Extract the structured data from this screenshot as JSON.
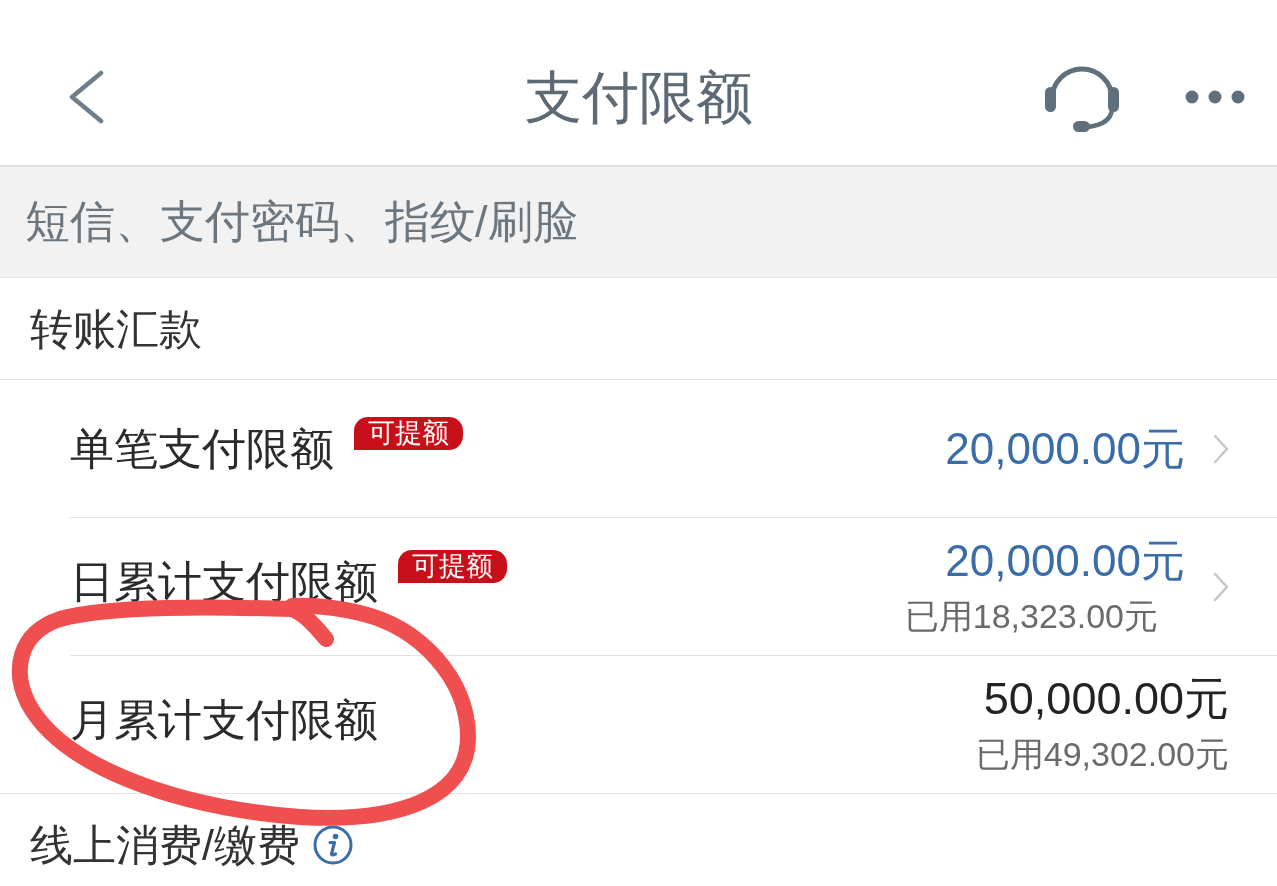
{
  "nav": {
    "title": "支付限额"
  },
  "verification_methods": "短信、支付密码、指纹/刷脸",
  "sections": [
    {
      "title": "转账汇款",
      "info": false,
      "rows": [
        {
          "label": "单笔支付限额",
          "badge": "可提额",
          "value": "20,000.00元",
          "editable": true,
          "circled": false
        },
        {
          "label": "日累计支付限额",
          "badge": "可提额",
          "value": "20,000.00元",
          "used": "已用18,323.00元",
          "editable": true,
          "circled": false
        },
        {
          "label": "月累计支付限额",
          "value": "50,000.00元",
          "used": "已用49,302.00元",
          "editable": false,
          "circled": true
        }
      ]
    },
    {
      "title": "线上消费/缴费",
      "info": true
    }
  ]
}
